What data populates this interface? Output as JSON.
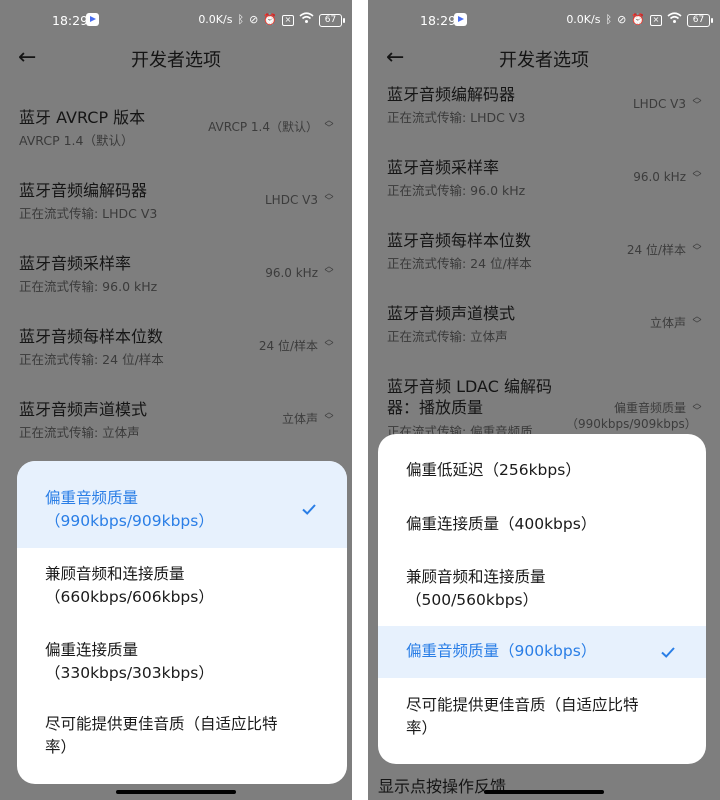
{
  "colors": {
    "accent": "#2a7ee6",
    "selected_bg": "#e7f1fd",
    "scrim": "#7e7e7e"
  },
  "left": {
    "status": {
      "time": "18:29",
      "net_speed": "0.0K/s",
      "battery": "67"
    },
    "appbar": {
      "title": "开发者选项",
      "back_icon": "arrow-left-icon"
    },
    "settings": [
      {
        "name": "蓝牙 AVRCP 版本",
        "sub": "AVRCP 1.4（默认）",
        "value": "AVRCP 1.4（默认）"
      },
      {
        "name": "蓝牙音频编解码器",
        "sub": "正在流式传输: LHDC V3",
        "value": "LHDC V3"
      },
      {
        "name": "蓝牙音频采样率",
        "sub": "正在流式传输: 96.0 kHz",
        "value": "96.0 kHz"
      },
      {
        "name": "蓝牙音频每样本位数",
        "sub": "正在流式传输: 24 位/样本",
        "value": "24 位/样本"
      },
      {
        "name": "蓝牙音频声道模式",
        "sub": "正在流式传输: 立体声",
        "value": "立体声"
      }
    ],
    "options": [
      {
        "label": "偏重音频质量（990kbps/909kbps）",
        "selected": true
      },
      {
        "label": "兼顾音频和连接质量（660kbps/606kbps）",
        "selected": false
      },
      {
        "label": "偏重连接质量（330kbps/303kbps）",
        "selected": false
      },
      {
        "label": "尽可能提供更佳音质（自适应比特率）",
        "selected": false
      }
    ]
  },
  "right": {
    "status": {
      "time": "18:29",
      "net_speed": "0.0K/s",
      "battery": "67"
    },
    "appbar": {
      "title": "开发者选项",
      "back_icon": "arrow-left-icon"
    },
    "settings": [
      {
        "name": "蓝牙音频编解码器",
        "sub": "正在流式传输: LHDC V3",
        "value": "LHDC V3"
      },
      {
        "name": "蓝牙音频采样率",
        "sub": "正在流式传输: 96.0 kHz",
        "value": "96.0 kHz"
      },
      {
        "name": "蓝牙音频每样本位数",
        "sub": "正在流式传输: 24 位/样本",
        "value": "24 位/样本"
      },
      {
        "name": "蓝牙音频声道模式",
        "sub": "正在流式传输: 立体声",
        "value": "立体声"
      },
      {
        "name": "蓝牙音频 LDAC 编解码器：播放质量",
        "sub": "正在流式传输: 偏重音频质",
        "value": "偏重音频质量（990kbps/909kbps）"
      }
    ],
    "options": [
      {
        "label": "偏重低延迟（256kbps）",
        "selected": false
      },
      {
        "label": "偏重连接质量（400kbps）",
        "selected": false
      },
      {
        "label": "兼顾音频和连接质量（500/560kbps）",
        "selected": false
      },
      {
        "label": "偏重音频质量（900kbps）",
        "selected": true
      },
      {
        "label": "尽可能提供更佳音质（自适应比特率）",
        "selected": false
      }
    ],
    "peek_text": "显示点按操作反馈"
  }
}
